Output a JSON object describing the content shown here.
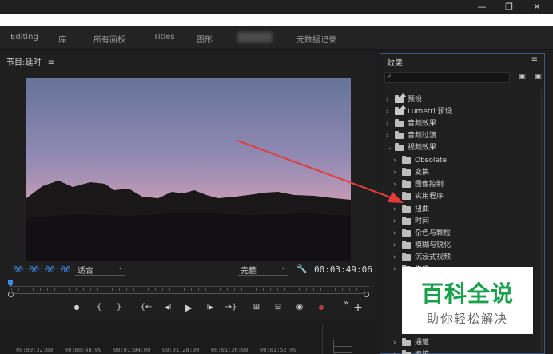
{
  "window": {
    "minimize_glyph": "—",
    "maximize_glyph": "❐",
    "close_glyph": "✕"
  },
  "workspaces": [
    "Editing",
    "库",
    "所有面板",
    "Titles",
    "图形",
    "元数据记录"
  ],
  "monitor": {
    "title": "节目:延时",
    "menu_glyph": "≡",
    "current_timecode": "00:00:00:00",
    "fit_option": "适合",
    "quality_option": "完整",
    "duration": "00:03:49:06",
    "controls": {
      "marker": "●",
      "mark_in": "{",
      "mark_out": "}",
      "go_to_in": "{←",
      "step_back": "◀I",
      "play": "▶",
      "step_forward": "I▶",
      "go_to_out": "→}",
      "insert": "⊞",
      "overwrite": "⊟",
      "export_frame": "◉",
      "record": "●",
      "more": "»",
      "add": "+"
    }
  },
  "timeline": {
    "ruler_labels": [
      "00:00:32:00",
      "00:00:48:00",
      "00:01:04:00",
      "00:01:20:00",
      "00:01:36:00",
      "00:01:52:00"
    ]
  },
  "effects": {
    "title": "效果",
    "menu_glyph": "≡",
    "search_placeholder": "",
    "items": [
      {
        "label": "预设",
        "twisty": "›",
        "icon": "preset"
      },
      {
        "label": "Lumetri 预设",
        "twisty": "›",
        "icon": "preset"
      },
      {
        "label": "音频效果",
        "twisty": "›",
        "icon": "folder"
      },
      {
        "label": "音频过渡",
        "twisty": "›",
        "icon": "folder"
      },
      {
        "label": "视频效果",
        "twisty": "⌄",
        "icon": "folder"
      },
      {
        "label": "Obsolete",
        "twisty": "›",
        "icon": "folder"
      },
      {
        "label": "变换",
        "twisty": "›",
        "icon": "folder"
      },
      {
        "label": "图像控制",
        "twisty": "›",
        "icon": "folder"
      },
      {
        "label": "实用程序",
        "twisty": "›",
        "icon": "folder"
      },
      {
        "label": "扭曲",
        "twisty": "›",
        "icon": "folder"
      },
      {
        "label": "时间",
        "twisty": "›",
        "icon": "folder"
      },
      {
        "label": "杂色与颗粒",
        "twisty": "›",
        "icon": "folder"
      },
      {
        "label": "模糊与锐化",
        "twisty": "›",
        "icon": "folder"
      },
      {
        "label": "沉浸式视频",
        "twisty": "›",
        "icon": "folder"
      },
      {
        "label": "生成",
        "twisty": "›",
        "icon": "folder"
      },
      {
        "label": "通道",
        "twisty": "›",
        "icon": "folder"
      },
      {
        "label": "键控",
        "twisty": "›",
        "icon": "folder"
      }
    ]
  },
  "watermark": {
    "main": "百科全说",
    "sub": "助你轻松解决"
  },
  "colors": {
    "accent": "#3d8ee8",
    "annotation_arrow": "#e63b3b",
    "watermark_green": "#19a04d"
  }
}
